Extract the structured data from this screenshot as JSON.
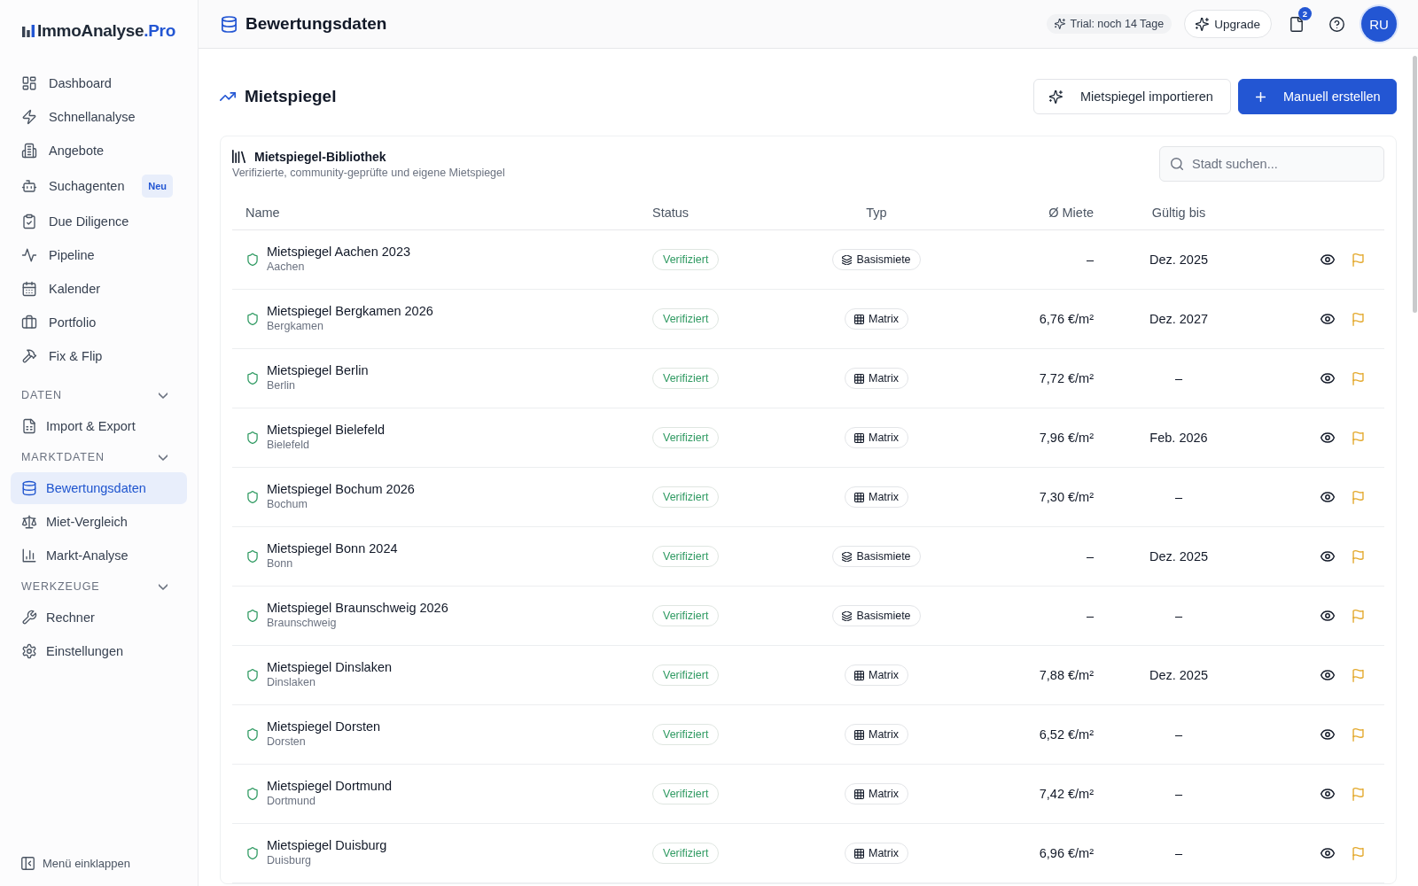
{
  "sidebar": {
    "logo": {
      "name": "ImmoAnalyse",
      "suffix": ".Pro"
    },
    "items": [
      {
        "label": "Dashboard",
        "selected": false
      },
      {
        "label": "Schnellanalyse",
        "selected": false
      },
      {
        "label": "Angebote",
        "selected": false
      },
      {
        "label": "Suchagenten",
        "selected": false,
        "badge": "Neu"
      },
      {
        "label": "Due Diligence",
        "selected": false
      },
      {
        "label": "Pipeline",
        "selected": false
      },
      {
        "label": "Kalender",
        "selected": false
      },
      {
        "label": "Portfolio",
        "selected": false
      },
      {
        "label": "Fix & Flip",
        "selected": false
      }
    ],
    "groups": [
      {
        "title": "DATEN",
        "expanded": true,
        "items": [
          {
            "label": "Import & Export",
            "selected": false
          }
        ]
      },
      {
        "title": "MARKTDATEN",
        "expanded": true,
        "items": [
          {
            "label": "Bewertungsdaten",
            "selected": true
          },
          {
            "label": "Miet-Vergleich",
            "selected": false
          },
          {
            "label": "Markt-Analyse",
            "selected": false
          }
        ]
      },
      {
        "title": "WERKZEUGE",
        "expanded": true,
        "items": [
          {
            "label": "Rechner",
            "selected": false
          },
          {
            "label": "Einstellungen",
            "selected": false
          }
        ]
      }
    ],
    "collapse_button": "Menü einklappen"
  },
  "header": {
    "title": "Bewertungsdaten",
    "trial": "Trial: noch 14 Tage",
    "upgrade_button": "Upgrade",
    "notification_count": "2",
    "avatar": "RU"
  },
  "page": {
    "title": "Mietspiegel",
    "actions": [
      {
        "kind": "secondary",
        "label": "Mietspiegel importieren"
      },
      {
        "kind": "primary",
        "label": "Manuell erstellen"
      }
    ],
    "library": {
      "title": "Mietspiegel-Bibliothek",
      "subtitle": "Verifizierte, community-geprüfte und eigene Mietspiegel",
      "search": {
        "placeholder": "Stadt suchen..."
      },
      "columns": [
        "Name",
        "Status",
        "Typ",
        "Ø Miete",
        "Gültig bis"
      ],
      "rows": [
        {
          "name": "Mietspiegel Aachen 2023",
          "city": "Aachen",
          "status": {
            "kind": "verified",
            "label": "Verifiziert"
          },
          "type": {
            "kind": "base",
            "label": "Basismiete"
          },
          "rent": "–",
          "valid_until": "Dez. 2025"
        },
        {
          "name": "Mietspiegel Bergkamen 2026",
          "city": "Bergkamen",
          "status": {
            "kind": "verified",
            "label": "Verifiziert"
          },
          "type": {
            "kind": "matrix",
            "label": "Matrix"
          },
          "rent": "6,76 €/m²",
          "valid_until": "Dez. 2027"
        },
        {
          "name": "Mietspiegel Berlin",
          "city": "Berlin",
          "status": {
            "kind": "verified",
            "label": "Verifiziert"
          },
          "type": {
            "kind": "matrix",
            "label": "Matrix"
          },
          "rent": "7,72 €/m²",
          "valid_until": "–"
        },
        {
          "name": "Mietspiegel Bielefeld",
          "city": "Bielefeld",
          "status": {
            "kind": "verified",
            "label": "Verifiziert"
          },
          "type": {
            "kind": "matrix",
            "label": "Matrix"
          },
          "rent": "7,96 €/m²",
          "valid_until": "Feb. 2026"
        },
        {
          "name": "Mietspiegel Bochum 2026",
          "city": "Bochum",
          "status": {
            "kind": "verified",
            "label": "Verifiziert"
          },
          "type": {
            "kind": "matrix",
            "label": "Matrix"
          },
          "rent": "7,30 €/m²",
          "valid_until": "–"
        },
        {
          "name": "Mietspiegel Bonn 2024",
          "city": "Bonn",
          "status": {
            "kind": "verified",
            "label": "Verifiziert"
          },
          "type": {
            "kind": "base",
            "label": "Basismiete"
          },
          "rent": "–",
          "valid_until": "Dez. 2025"
        },
        {
          "name": "Mietspiegel Braunschweig 2026",
          "city": "Braunschweig",
          "status": {
            "kind": "verified",
            "label": "Verifiziert"
          },
          "type": {
            "kind": "base",
            "label": "Basismiete"
          },
          "rent": "–",
          "valid_until": "–"
        },
        {
          "name": "Mietspiegel Dinslaken",
          "city": "Dinslaken",
          "status": {
            "kind": "verified",
            "label": "Verifiziert"
          },
          "type": {
            "kind": "matrix",
            "label": "Matrix"
          },
          "rent": "7,88 €/m²",
          "valid_until": "Dez. 2025"
        },
        {
          "name": "Mietspiegel Dorsten",
          "city": "Dorsten",
          "status": {
            "kind": "verified",
            "label": "Verifiziert"
          },
          "type": {
            "kind": "matrix",
            "label": "Matrix"
          },
          "rent": "6,52 €/m²",
          "valid_until": "–"
        },
        {
          "name": "Mietspiegel Dortmund",
          "city": "Dortmund",
          "status": {
            "kind": "verified",
            "label": "Verifiziert"
          },
          "type": {
            "kind": "matrix",
            "label": "Matrix"
          },
          "rent": "7,42 €/m²",
          "valid_until": "–"
        },
        {
          "name": "Mietspiegel Duisburg",
          "city": "Duisburg",
          "status": {
            "kind": "verified",
            "label": "Verifiziert"
          },
          "type": {
            "kind": "matrix",
            "label": "Matrix"
          },
          "rent": "6,96 €/m²",
          "valid_until": "–"
        }
      ]
    }
  }
}
